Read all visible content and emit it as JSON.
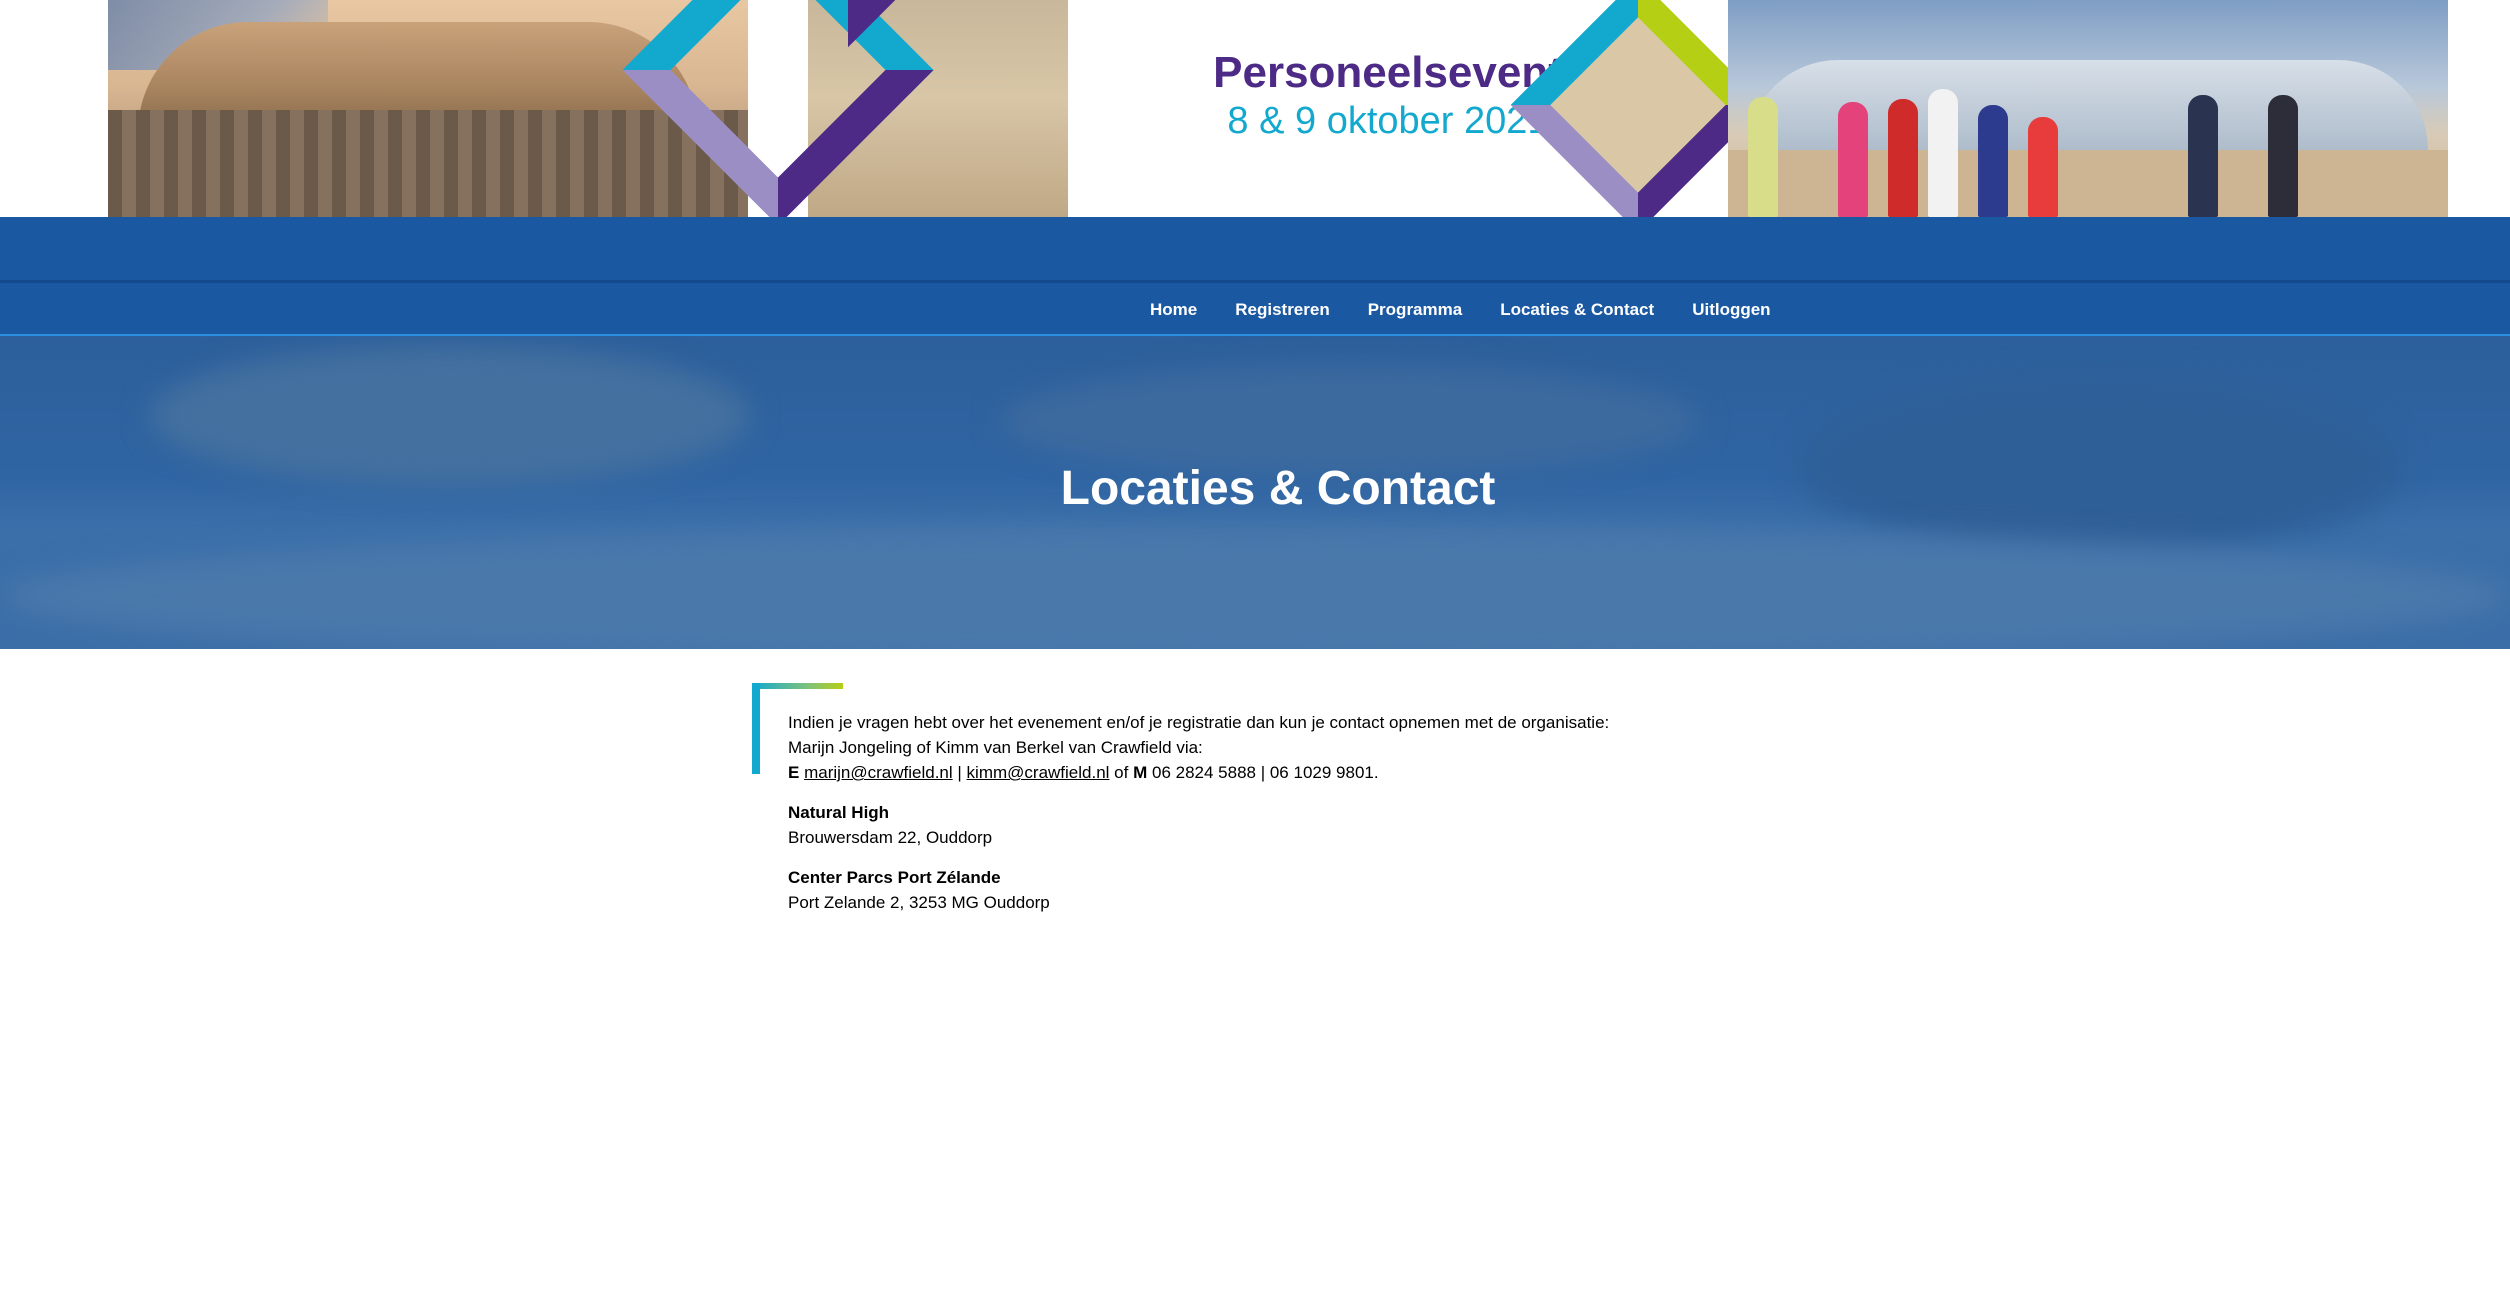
{
  "header": {
    "event_title": "Personeelsevent",
    "event_date": "8 & 9 oktober 2021"
  },
  "colors": {
    "nav_blue": "#1b58a2",
    "title_purple": "#4c2a86",
    "date_cyan": "#13a9cf",
    "accent_lime": "#b5cf15",
    "accent_lavender": "#9b8ec4"
  },
  "nav": {
    "items": [
      {
        "label": "Home"
      },
      {
        "label": "Registreren"
      },
      {
        "label": "Programma"
      },
      {
        "label": "Locaties & Contact"
      },
      {
        "label": "Uitloggen"
      }
    ]
  },
  "hero": {
    "title": "Locaties & Contact"
  },
  "content": {
    "intro_line1": "Indien je vragen hebt over het evenement en/of je registratie dan kun je contact opnemen met de organisatie:",
    "intro_line2": "Marijn Jongeling of Kimm van Berkel van Crawfield via:",
    "email_prefix": "E",
    "email_1": "marijn@crawfield.nl",
    "separator": "|",
    "email_2": "kimm@crawfield.nl",
    "of_text": "of",
    "mobile_prefix": "M",
    "phones": "06 2824 5888 | 06 1029 9801.",
    "location_1": {
      "name": "Natural High",
      "address": "Brouwersdam 22, Ouddorp"
    },
    "location_2": {
      "name": "Center Parcs Port Zélande",
      "address": "Port Zelande 2, 3253 MG Ouddorp"
    }
  }
}
